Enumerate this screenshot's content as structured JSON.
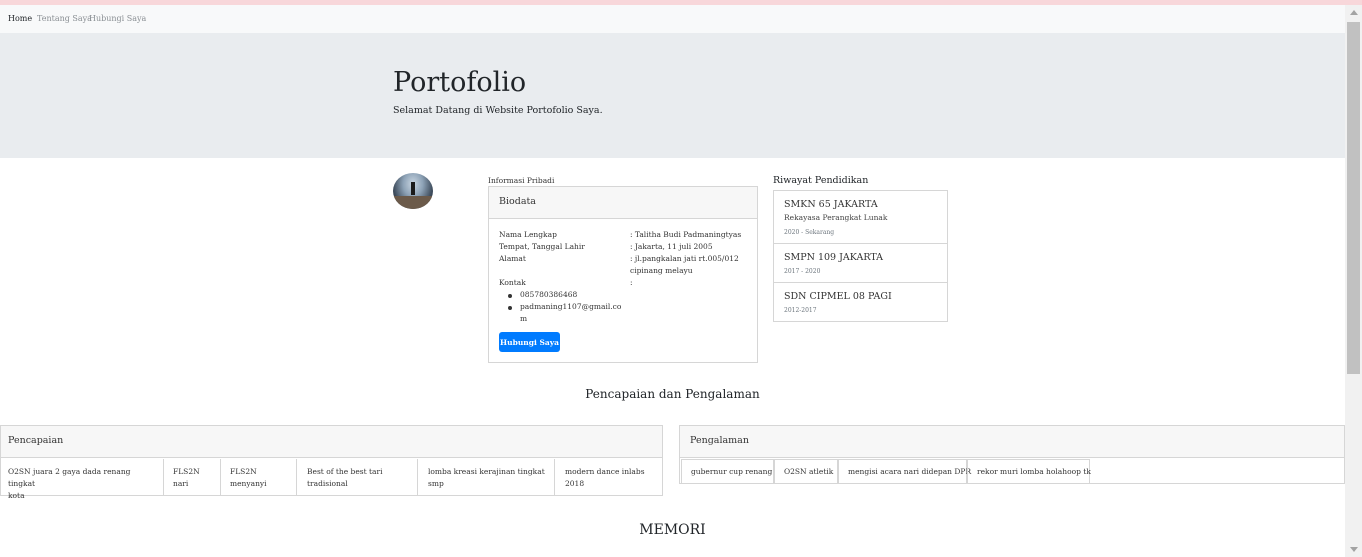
{
  "nav": {
    "home": "Home",
    "about": "Tentang Saya",
    "contact": "Hubungi Saya"
  },
  "jumbotron": {
    "title": "Portofolio",
    "lead": "Selamat Datang di Website Portofolio Saya."
  },
  "profile": {
    "section_label": "Informasi Pribadi",
    "card_title": "Biodata",
    "name_label": "Nama Lengkap",
    "name_value": ": Talitha Budi Padmaningtyas",
    "birth_label": "Tempat, Tanggal Lahir",
    "birth_value": ": Jakarta, 11 juli 2005",
    "address_label": "Alamat",
    "address_line1": ": jl.pangkalan jati rt.005/012",
    "address_line2": "cipinang melayu",
    "contact_label": "Kontak",
    "contact_colon": ":",
    "phone": "085780386468",
    "email_line1": "padmaning1107@gmail.co",
    "email_line2": "m",
    "button_label": "Hubungi Saya"
  },
  "education": {
    "title": "Riwayat Pendidikan",
    "items": [
      {
        "school": "SMKN 65 JAKARTA",
        "major": "Rekayasa Perangkat Lunak",
        "years": "2020 - Sekarang"
      },
      {
        "school": "SMPN 109 JAKARTA",
        "years": "2017 - 2020"
      },
      {
        "school": "SDN CIPMEL 08 PAGI",
        "years": "2012-2017"
      }
    ]
  },
  "achievements_section_title": "Pencapaian dan Pengalaman",
  "achievements": {
    "title": "Pencapaian",
    "items": [
      {
        "line1": "O2SN juara 2 gaya dada renang tingkat",
        "line2": "kota"
      },
      {
        "line1": "FLS2N",
        "line2": "nari"
      },
      {
        "line1": "FLS2N",
        "line2": "menyanyi"
      },
      {
        "line1": "Best of the best tari",
        "line2": "tradisional"
      },
      {
        "line1": "lomba kreasi kerajinan tingkat",
        "line2": "smp"
      },
      {
        "line1": "modern dance inlabs",
        "line2": "2018"
      }
    ]
  },
  "experience": {
    "title": "Pengalaman",
    "items": [
      "gubernur cup renang",
      "O2SN atletik",
      "mengisi acara nari didepan DPR",
      "rekor muri lomba holahoop tk"
    ]
  },
  "memori_title": "MEMORI",
  "colors": {
    "primary": "#007bff",
    "jumbotron": "#e9ecef",
    "navbar": "#f8f9fa",
    "top_strip": "#f8d7da"
  }
}
